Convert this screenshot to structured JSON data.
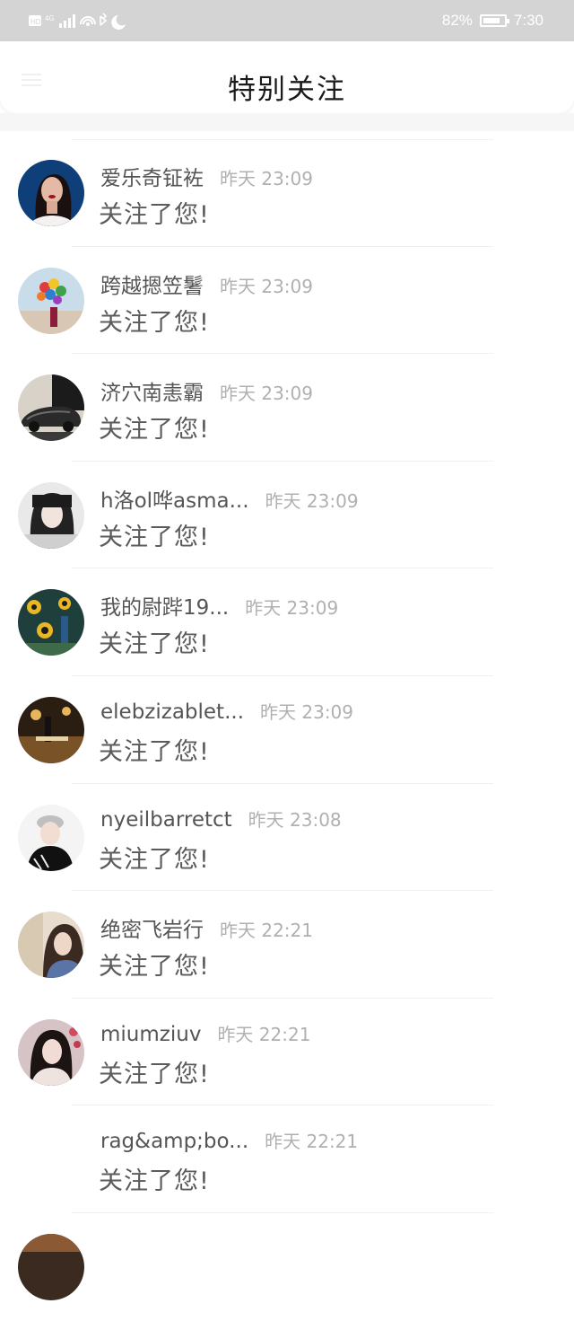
{
  "status_bar": {
    "left_icons_text": "HD 4G⁺ .ıl",
    "battery": "82%",
    "time": "7:30"
  },
  "header": {
    "title": "特别关注"
  },
  "items": [
    {
      "name": "爱乐奇钲袏",
      "time": "昨天 23:09",
      "text": "关注了您!"
    },
    {
      "name": "跨越摁笠鬐",
      "time": "昨天 23:09",
      "text": "关注了您!"
    },
    {
      "name": "济穴南恚霸",
      "time": "昨天 23:09",
      "text": "关注了您!"
    },
    {
      "name": "h洛ol哗asma...",
      "time": "昨天 23:09",
      "text": "关注了您!"
    },
    {
      "name": "我的尉跸19...",
      "time": "昨天 23:09",
      "text": "关注了您!"
    },
    {
      "name": "elebzizablet...",
      "time": "昨天 23:09",
      "text": "关注了您!"
    },
    {
      "name": "nyeilbarretct",
      "time": "昨天 23:08",
      "text": "关注了您!"
    },
    {
      "name": "绝密飞岩行",
      "time": "昨天 22:21",
      "text": "关注了您!"
    },
    {
      "name": "miumziuv",
      "time": "昨天 22:21",
      "text": "关注了您!"
    },
    {
      "name": "rag&amp;bo...",
      "time": "昨天 22:21",
      "text": "关注了您!"
    }
  ]
}
